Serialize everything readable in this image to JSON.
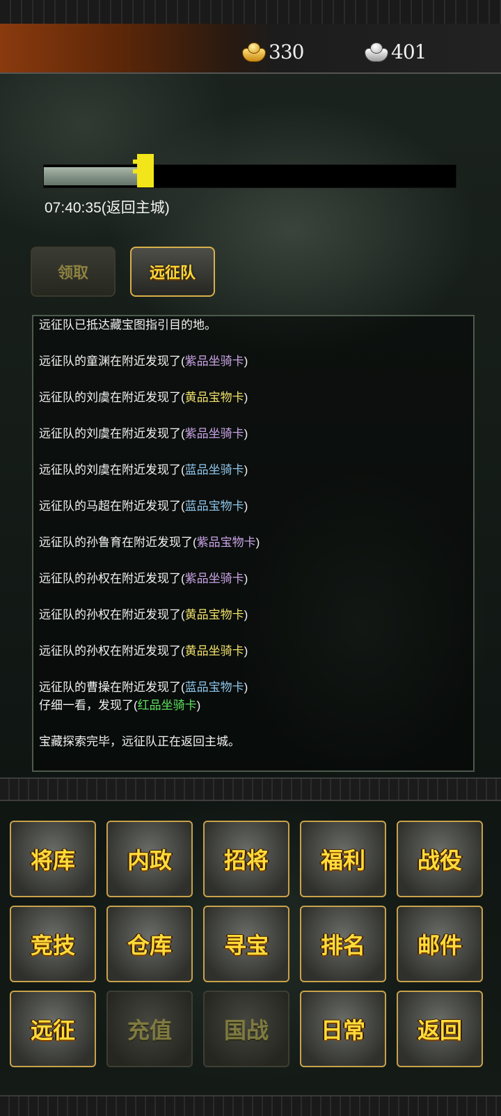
{
  "header": {
    "gold": {
      "icon": "gold-ingot-icon",
      "value": "330"
    },
    "silver": {
      "icon": "silver-ingot-icon",
      "value": "401"
    }
  },
  "expedition": {
    "progress": 0.23,
    "timer_text": "07:40:35(返回主城)",
    "claim_label": "领取",
    "team_label": "远征队"
  },
  "log": {
    "intro": "远征队已抵达藏宝图指引目的地。",
    "entries": [
      {
        "prefix": "远征队的童渊在附近发现了(",
        "item": "紫品坐骑卡",
        "suffix": ")",
        "color": "#c9a3e6"
      },
      {
        "prefix": "远征队的刘虞在附近发现了(",
        "item": "黄品宝物卡",
        "suffix": ")",
        "color": "#f0e06a"
      },
      {
        "prefix": "远征队的刘虞在附近发现了(",
        "item": "紫品坐骑卡",
        "suffix": ")",
        "color": "#c9a3e6"
      },
      {
        "prefix": "远征队的刘虞在附近发现了(",
        "item": "蓝品坐骑卡",
        "suffix": ")",
        "color": "#8ec5ea"
      },
      {
        "prefix": "远征队的马超在附近发现了(",
        "item": "蓝品宝物卡",
        "suffix": ")",
        "color": "#8ec5ea"
      },
      {
        "prefix": "远征队的孙鲁育在附近发现了(",
        "item": "紫品宝物卡",
        "suffix": ")",
        "color": "#c9a3e6"
      },
      {
        "prefix": "远征队的孙权在附近发现了(",
        "item": "紫品坐骑卡",
        "suffix": ")",
        "color": "#c9a3e6"
      },
      {
        "prefix": "远征队的孙权在附近发现了(",
        "item": "黄品宝物卡",
        "suffix": ")",
        "color": "#f0e06a"
      },
      {
        "prefix": "远征队的孙权在附近发现了(",
        "item": "黄品坐骑卡",
        "suffix": ")",
        "color": "#f0e06a"
      },
      {
        "prefix": "远征队的曹操在附近发现了(",
        "item": "蓝品宝物卡",
        "suffix": ")",
        "color": "#8ec5ea"
      }
    ],
    "bonus": {
      "prefix": "仔细一看，发现了(",
      "item": "红品坐骑卡",
      "suffix": ")",
      "color": "#5ee05e"
    },
    "finish": "宝藏探索完毕，远征队正在返回主城。"
  },
  "menu": [
    {
      "label": "将库",
      "enabled": true
    },
    {
      "label": "内政",
      "enabled": true
    },
    {
      "label": "招将",
      "enabled": true
    },
    {
      "label": "福利",
      "enabled": true
    },
    {
      "label": "战役",
      "enabled": true
    },
    {
      "label": "竞技",
      "enabled": true
    },
    {
      "label": "仓库",
      "enabled": true
    },
    {
      "label": "寻宝",
      "enabled": true
    },
    {
      "label": "排名",
      "enabled": true
    },
    {
      "label": "邮件",
      "enabled": true
    },
    {
      "label": "远征",
      "enabled": true
    },
    {
      "label": "充值",
      "enabled": false
    },
    {
      "label": "国战",
      "enabled": false
    },
    {
      "label": "日常",
      "enabled": true
    },
    {
      "label": "返回",
      "enabled": true
    }
  ]
}
